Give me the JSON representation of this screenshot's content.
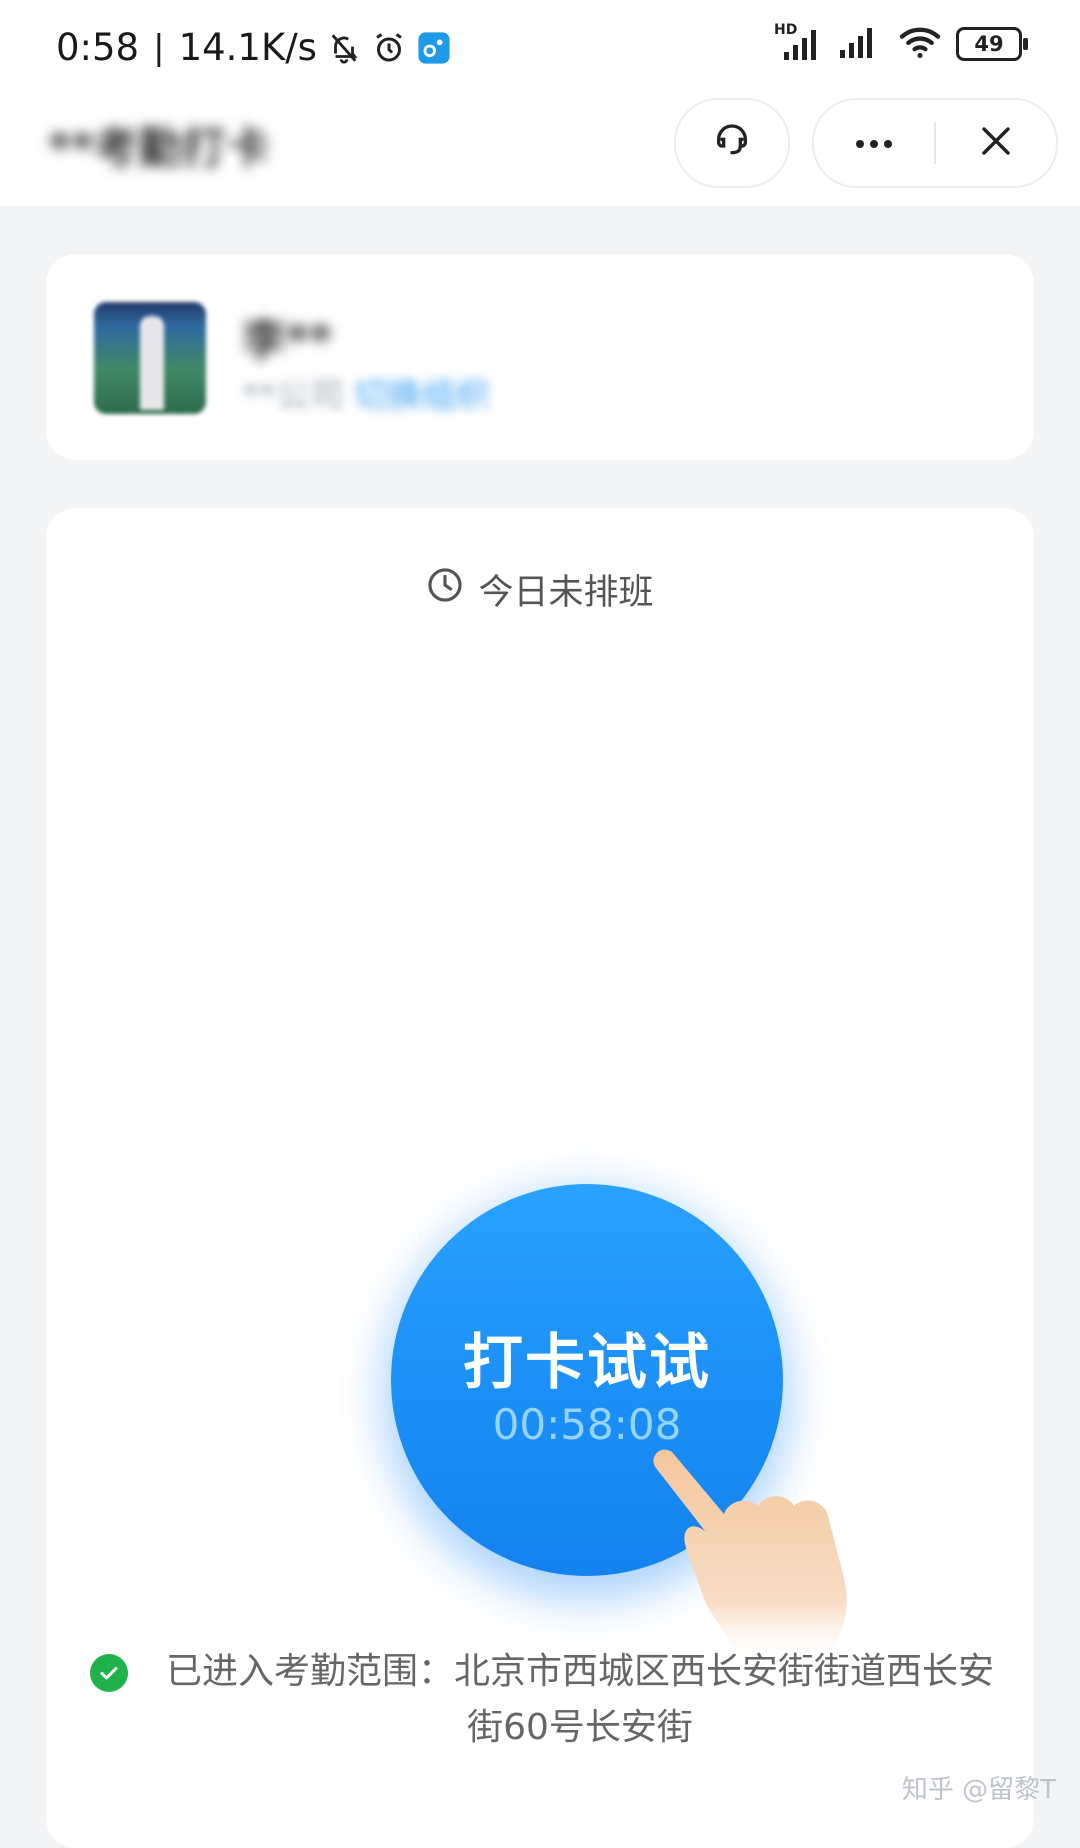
{
  "status_bar": {
    "time": "0:58",
    "separator": "|",
    "net_speed": "14.1K/s",
    "battery": "49",
    "network_badge": "HD",
    "icons": [
      "mute-bell-icon",
      "alarm-icon",
      "app-notification-icon",
      "signal-icon",
      "signal-icon",
      "wifi-icon",
      "battery-icon"
    ]
  },
  "app_bar": {
    "title": "**考勤打卡",
    "support_icon": "customer-service-icon",
    "more_icon": "more-icon",
    "close_icon": "close-icon"
  },
  "profile": {
    "name": "李**",
    "subtitle": "**公司",
    "link": "切换组织"
  },
  "punch": {
    "schedule_icon": "clock-icon",
    "schedule_text": "今日未排班",
    "button_label": "打卡试试",
    "button_time": "00:58:08",
    "geofence_icon": "check-circle-icon",
    "geofence_text": "已进入考勤范围：北京市西城区西长安街街道西长安街60号长安街"
  },
  "watermark": "知乎 @留黎T",
  "colors": {
    "primary": "#1b8ff6",
    "success": "#1fb24a",
    "background": "#f3f4f6",
    "time_text": "#94d4ff"
  }
}
